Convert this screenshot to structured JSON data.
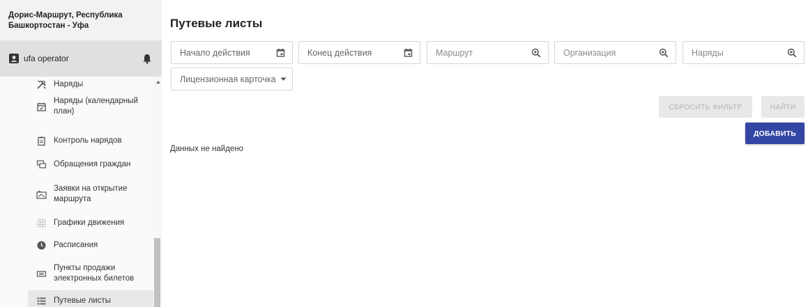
{
  "sidebar": {
    "brand": "Дорис-Маршрут, Республика Башкортостан - Уфа",
    "user": "ufa operator",
    "items": [
      {
        "label": "Наряды",
        "icon": "tools-icon"
      },
      {
        "label": "Наряды (календарный план)",
        "icon": "calendar-check-icon"
      },
      {
        "label": "Контроль нарядов",
        "icon": "clipboard-icon"
      },
      {
        "label": "Обращения граждан",
        "icon": "chat-icon"
      },
      {
        "label": "Заявки на открытие маршрута",
        "icon": "route-request-icon"
      },
      {
        "label": "Графики движения",
        "icon": "grid-icon"
      },
      {
        "label": "Расписания",
        "icon": "clock-icon"
      },
      {
        "label": "Пункты продажи электронных билетов",
        "icon": "ticket-icon"
      },
      {
        "label": "Путевые листы",
        "icon": "list-icon",
        "active": true
      }
    ]
  },
  "main": {
    "title": "Путевые листы",
    "filters": {
      "start": "Начало действия",
      "end": "Конец действия",
      "route": "Маршрут",
      "organization": "Организация",
      "orders": "Наряды",
      "license_card": "Лицензионная карточка"
    },
    "buttons": {
      "reset": "СБРОСИТЬ ФИЛЬТР",
      "find": "НАЙТИ",
      "add": "ДОБАВИТЬ"
    },
    "empty": "Данных не найдено"
  },
  "colors": {
    "primary": "#3446a4",
    "sidebar_bg": "#fafafa",
    "userbar_bg": "#e0e0e0"
  }
}
